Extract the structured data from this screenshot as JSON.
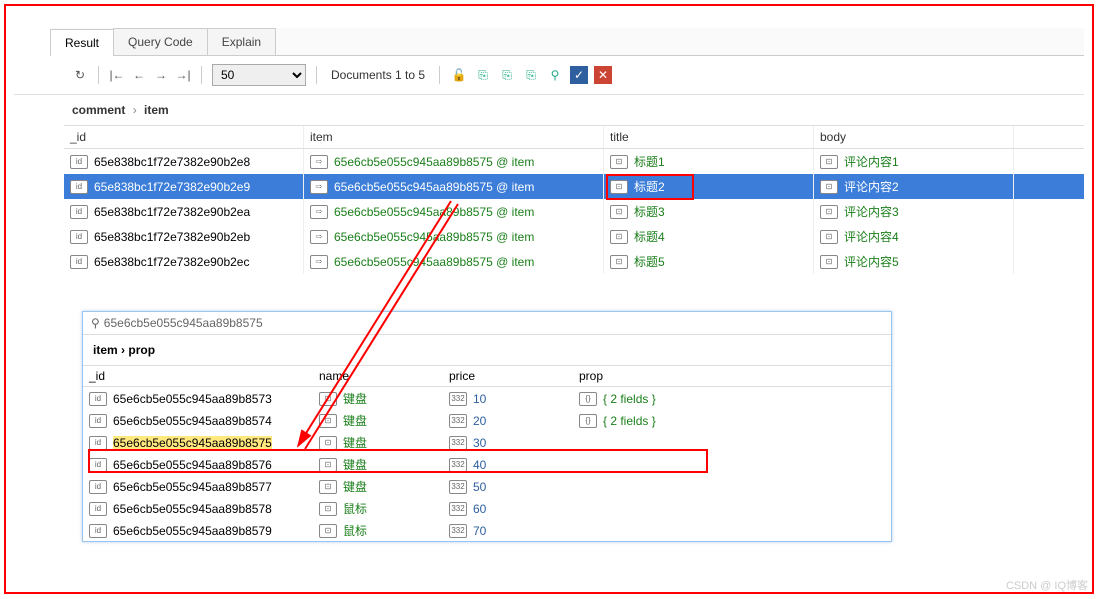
{
  "tabs": {
    "result": "Result",
    "queryCode": "Query Code",
    "explain": "Explain"
  },
  "toolbar": {
    "pageSize": "50",
    "docRange": "Documents 1 to 5"
  },
  "crumb1": {
    "a": "comment",
    "b": "item"
  },
  "grid1": {
    "headers": {
      "id": "_id",
      "item": "item",
      "title": "title",
      "body": "body"
    },
    "rows": [
      {
        "id": "65e838bc1f72e7382e90b2e8",
        "item": "65e6cb5e055c945aa89b8575 @ item",
        "title": "标题1",
        "body": "评论内容1"
      },
      {
        "id": "65e838bc1f72e7382e90b2e9",
        "item": "65e6cb5e055c945aa89b8575 @ item",
        "title": "标题2",
        "body": "评论内容2"
      },
      {
        "id": "65e838bc1f72e7382e90b2ea",
        "item": "65e6cb5e055c945aa89b8575 @ item",
        "title": "标题3",
        "body": "评论内容3"
      },
      {
        "id": "65e838bc1f72e7382e90b2eb",
        "item": "65e6cb5e055c945aa89b8575 @ item",
        "title": "标题4",
        "body": "评论内容4"
      },
      {
        "id": "65e838bc1f72e7382e90b2ec",
        "item": "65e6cb5e055c945aa89b8575 @ item",
        "title": "标题5",
        "body": "评论内容5"
      }
    ]
  },
  "panel2": {
    "search": "65e6cb5e055c945aa89b8575",
    "crumbA": "item",
    "crumbB": "prop",
    "headers": {
      "id": "_id",
      "name": "name",
      "price": "price",
      "prop": "prop"
    },
    "rows": [
      {
        "id": "65e6cb5e055c945aa89b8573",
        "name": "键盘",
        "price": "10",
        "prop": "{ 2 fields }"
      },
      {
        "id": "65e6cb5e055c945aa89b8574",
        "name": "键盘",
        "price": "20",
        "prop": "{ 2 fields }"
      },
      {
        "id": "65e6cb5e055c945aa89b8575",
        "name": "键盘",
        "price": "30",
        "prop": ""
      },
      {
        "id": "65e6cb5e055c945aa89b8576",
        "name": "键盘",
        "price": "40",
        "prop": ""
      },
      {
        "id": "65e6cb5e055c945aa89b8577",
        "name": "键盘",
        "price": "50",
        "prop": ""
      },
      {
        "id": "65e6cb5e055c945aa89b8578",
        "name": "鼠标",
        "price": "60",
        "prop": ""
      },
      {
        "id": "65e6cb5e055c945aa89b8579",
        "name": "鼠标",
        "price": "70",
        "prop": ""
      }
    ]
  },
  "typeLabels": {
    "id": "id",
    "ref": "⇨",
    "str": "⊡",
    "num": "332",
    "obj": "{}"
  },
  "watermark": "CSDN @ IQ博客"
}
